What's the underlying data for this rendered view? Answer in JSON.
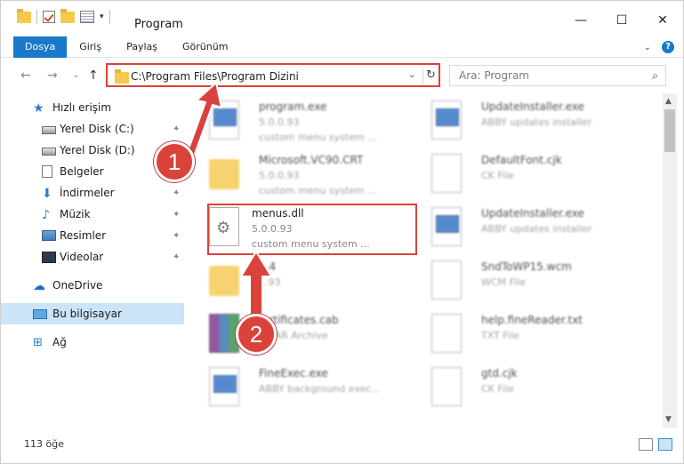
{
  "window": {
    "title": "Program",
    "minimize_glyph": "—",
    "maximize_glyph": "☐",
    "close_glyph": "✕"
  },
  "ribbon": {
    "tabs": [
      {
        "label": "Dosya",
        "active": true
      },
      {
        "label": "Giriş"
      },
      {
        "label": "Paylaş"
      },
      {
        "label": "Görünüm"
      }
    ],
    "help_glyph": "?",
    "collapse_glyph": "⌄"
  },
  "address": {
    "back_glyph": "←",
    "forward_glyph": "→",
    "recent_glyph": "⌄",
    "up_glyph": "↑",
    "path": "C:\\Program Files\\Program Dizini",
    "dropdown_glyph": "⌄",
    "refresh_glyph": "↻",
    "search_placeholder": "Ara: Program",
    "search_glyph": "⌕"
  },
  "sidebar": {
    "items": [
      {
        "label": "Hızlı erişim",
        "icon": "star-icon",
        "glyph": "★"
      },
      {
        "label": "Yerel Disk (C:)",
        "icon": "drive-icon",
        "pinned": true
      },
      {
        "label": "Yerel Disk (D:)",
        "icon": "drive-icon"
      },
      {
        "label": "Belgeler",
        "icon": "documents-icon",
        "pinned": true
      },
      {
        "label": "İndirmeler",
        "icon": "downloads-icon",
        "glyph": "⬇",
        "pinned": true
      },
      {
        "label": "Müzik",
        "icon": "music-icon",
        "glyph": "♪",
        "pinned": true
      },
      {
        "label": "Resimler",
        "icon": "pictures-icon",
        "pinned": true
      },
      {
        "label": "Videolar",
        "icon": "videos-icon",
        "pinned": true
      },
      {
        "label": "OneDrive",
        "icon": "onedrive-icon",
        "glyph": "☁"
      },
      {
        "label": "Bu bilgisayar",
        "icon": "this-pc-icon",
        "selected": true
      },
      {
        "label": "Ağ",
        "icon": "network-icon",
        "glyph": "⊞"
      }
    ],
    "pin_glyph": "✦"
  },
  "files": [
    {
      "name": "program.exe",
      "version": "5.0.0.93",
      "desc": "custom menu system ...",
      "icon": "exe-icon",
      "blur": true
    },
    {
      "name": "UpdateInstaller.exe",
      "version": "ABBY updates installer",
      "desc": "",
      "icon": "exe-icon",
      "blur": true
    },
    {
      "name": "Microsoft.VC90.CRT",
      "version": "5.0.0.93",
      "desc": "custom menu system ...",
      "icon": "folder-icon",
      "blur": true
    },
    {
      "name": "DefaultFont.cjk",
      "version": "CK File",
      "desc": "",
      "icon": "file-icon",
      "blur": true
    },
    {
      "name": "menus.dll",
      "version": "5.0.0.93",
      "desc": "custom menu system ...",
      "icon": "dll-icon",
      "blur": false
    },
    {
      "name": "UpdateInstaller.exe",
      "version": "ABBY updates installer",
      "desc": "",
      "icon": "exe-icon",
      "blur": true
    },
    {
      "name": "...4",
      "version": "...93",
      "desc": "",
      "icon": "folder-icon",
      "blur": true
    },
    {
      "name": "SndToWP15.wcm",
      "version": "WCM File",
      "desc": "",
      "icon": "file-icon",
      "blur": true
    },
    {
      "name": "...rtificates.cab",
      "version": "...RAR Archive",
      "desc": "",
      "icon": "archive-icon",
      "blur": true
    },
    {
      "name": "help.fineReader.txt",
      "version": "TXT File",
      "desc": "",
      "icon": "file-icon",
      "blur": true
    },
    {
      "name": "FineExec.exe",
      "version": "ABBY background exec...",
      "desc": "",
      "icon": "exe-icon",
      "blur": true
    },
    {
      "name": "gtd.cjk",
      "version": "CK File",
      "desc": "",
      "icon": "file-icon",
      "blur": true
    }
  ],
  "status": {
    "item_count": "113 öğe"
  },
  "annotations": {
    "step1": "1",
    "step2": "2"
  },
  "colors": {
    "accent": "#1979ca",
    "highlight": "#d9433b",
    "selection": "#cce4f7"
  }
}
